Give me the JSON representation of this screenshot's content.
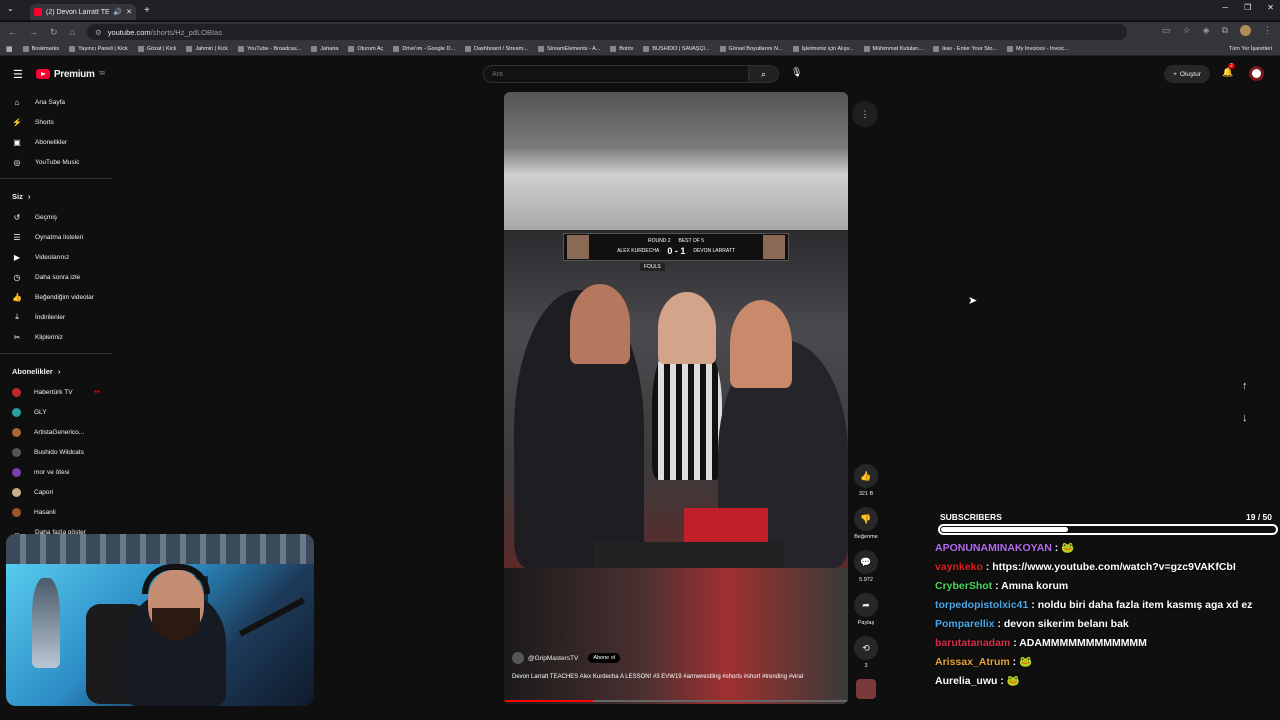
{
  "browser": {
    "tab_title": "(2) Devon Larratt TEACHES",
    "url_host": "youtube.com",
    "url_path": "/shorts/Hz_pdLOBIas",
    "bookmarks": [
      "Bookmarks",
      "Yayıncı Paneli | Kick",
      "Gözat | Kick",
      "Jahmin | Kick",
      "YouTube - Broadcas...",
      "Jaharia",
      "Oturum Aç",
      "Drive'ım - Google D...",
      "Dashboard / Stream...",
      "StreamElements - A...",
      "Botrix",
      "BUSHIDO | SAVAŞÇI...",
      "Görsel Boyutlarını N...",
      "İşletmeniz için Alışv...",
      "Mühimmat Kutuları...",
      "ikas - Enter Your Sto...",
      "My Invoices - Invoic..."
    ],
    "bookmarks_all": "Tüm Yer İşaretleri"
  },
  "header": {
    "logo": "Premium",
    "logo_sup": "TR",
    "search_placeholder": "Ara",
    "create_label": "Oluştur",
    "notif_count": "2"
  },
  "sidebar": {
    "main": [
      {
        "label": "Ana Sayfa",
        "icon": "⌂"
      },
      {
        "label": "Shorts",
        "icon": "⚡"
      },
      {
        "label": "Abonelikler",
        "icon": "▣"
      },
      {
        "label": "YouTube Music",
        "icon": "◎"
      }
    ],
    "you_header": "Siz",
    "you": [
      {
        "label": "Geçmiş",
        "icon": "↺"
      },
      {
        "label": "Oynatma listeleri",
        "icon": "☰"
      },
      {
        "label": "Videolarınız",
        "icon": "▶"
      },
      {
        "label": "Daha sonra izle",
        "icon": "◷"
      },
      {
        "label": "Beğendiğim videolar",
        "icon": "👍"
      },
      {
        "label": "İndirilenler",
        "icon": "⤓"
      },
      {
        "label": "Klipleriniz",
        "icon": "✂"
      }
    ],
    "subs_header": "Abonelikler",
    "subs": [
      {
        "label": "Habertürk TV",
        "color": "#c0282d"
      },
      {
        "label": "GLY",
        "color": "#2aa0a0"
      },
      {
        "label": "ArtistaGenerico...",
        "color": "#aa6633"
      },
      {
        "label": "Bushido Wildcats",
        "color": "#555555"
      },
      {
        "label": "mor ve ötesi",
        "color": "#7a3fb0"
      },
      {
        "label": "Capori",
        "color": "#c8b08a"
      },
      {
        "label": "Hasanli",
        "color": "#a0522d"
      }
    ],
    "show_more": "Daha fazla göster"
  },
  "video": {
    "score_round": "ROUND 2",
    "score_best": "BEST OF 5",
    "player_left": "ALEX KURDECHA",
    "player_right": "DEVON LARRATT",
    "score": "0 - 1",
    "fouls": "FOULS",
    "channel": "@GripMastersTV",
    "subscribe": "Abone ol",
    "title": "Devon Larratt TEACHES Alex Kurdecha A LESSON! #3 EVW19 #armwrestling #shorts #short #trending #viral",
    "progress": 0.26
  },
  "actions": {
    "likes": "321 B",
    "dislike": "Beğenme",
    "comments": "5.972",
    "share": "Paylaş",
    "remix": "3"
  },
  "chat": {
    "sub_label": "SUBSCRIBERS",
    "sub_count": "19 / 50",
    "sub_progress": 0.38,
    "messages": [
      {
        "user": "APONUNAMINAKOYAN",
        "color": "#b46cf0",
        "text": " : ",
        "emote": true
      },
      {
        "user": "vaynkeko",
        "color": "#e0201f",
        "text": " : https://www.youtube.com/watch?v=gzc9VAKfCbI",
        "emote": false
      },
      {
        "user": "CryberShot",
        "color": "#4cd460",
        "text": " : Amına korum",
        "emote": false
      },
      {
        "user": "torpedopistolxic41",
        "color": "#4aa8e8",
        "text": " : noldu biri daha fazla item kasmış aga xd ez",
        "emote": false
      },
      {
        "user": "Pomparellix",
        "color": "#4aa8e8",
        "text": " : devon sikerim belanı bak",
        "emote": false
      },
      {
        "user": "barutatanadam",
        "color": "#d6304a",
        "text": " : ADAMMMMMMMMMMMM",
        "emote": false
      },
      {
        "user": "Arissax_Atrum",
        "color": "#e6a23c",
        "text": " : ",
        "emote": true
      },
      {
        "user": "Aurelia_uwu",
        "color": "#ffffff",
        "text": " : ",
        "emote": true
      }
    ]
  }
}
